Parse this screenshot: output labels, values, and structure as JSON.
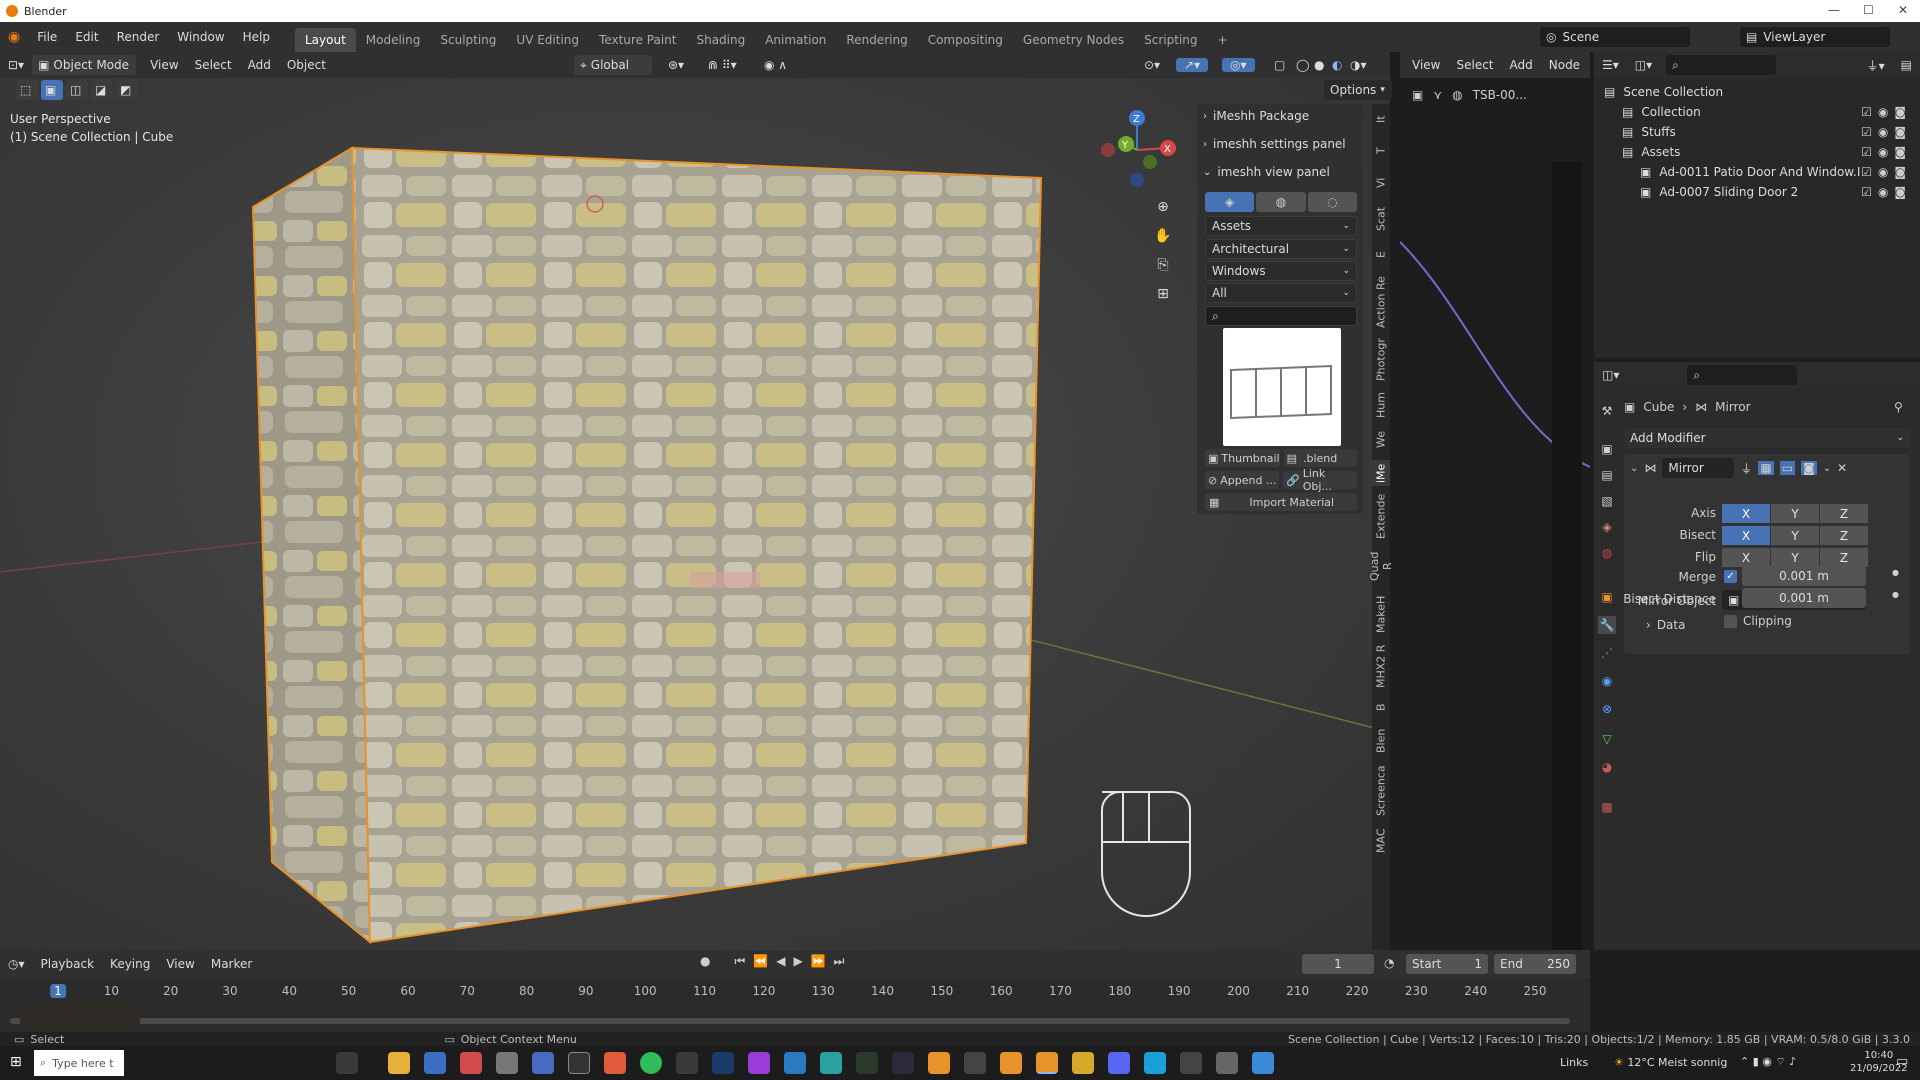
{
  "window": {
    "title": "Blender"
  },
  "menus": [
    "File",
    "Edit",
    "Render",
    "Window",
    "Help"
  ],
  "workspaces": [
    {
      "label": "Layout",
      "active": true
    },
    {
      "label": "Modeling"
    },
    {
      "label": "Sculpting"
    },
    {
      "label": "UV Editing"
    },
    {
      "label": "Texture Paint"
    },
    {
      "label": "Shading"
    },
    {
      "label": "Animation"
    },
    {
      "label": "Rendering"
    },
    {
      "label": "Compositing"
    },
    {
      "label": "Geometry Nodes"
    },
    {
      "label": "Scripting"
    }
  ],
  "scene": {
    "label": "Scene",
    "view_layer": "ViewLayer"
  },
  "viewport": {
    "mode": "Object Mode",
    "menus": [
      "View",
      "Select",
      "Add",
      "Object"
    ],
    "orientation": "Global",
    "options": "Options",
    "perspective": "User Perspective",
    "collection_info": "(1) Scene Collection | Cube",
    "gizmo": {
      "x": "X",
      "y": "Y",
      "z": "Z"
    }
  },
  "npanel": {
    "sections": [
      {
        "label": "iMeshh Package",
        "open": false
      },
      {
        "label": "imeshh settings panel",
        "open": false
      },
      {
        "label": "imeshh view panel",
        "open": true
      }
    ],
    "dropdowns": [
      "Assets",
      "Architectural",
      "Windows",
      "All"
    ],
    "thumbnail_btn": "Thumbnail",
    "blend_btn": ".blend",
    "append_btn": "Append ...",
    "link_btn": "Link Obj...",
    "import_material": "Import Material"
  },
  "vtabs": [
    "It",
    "T",
    "Vi",
    "Scat",
    "E",
    "Action Re",
    "Photogr",
    "Hum",
    "We",
    "iMe",
    "Extende",
    "Quad R",
    "MakeH",
    "MHX2 R",
    "B",
    "Blen",
    "Screenca",
    "MAC"
  ],
  "node_editor": {
    "menus": [
      "View",
      "Select",
      "Add",
      "Node"
    ],
    "breadcrumb": "TSB-00..."
  },
  "outliner": {
    "rows": [
      {
        "label": "Scene Collection",
        "depth": 0
      },
      {
        "label": "Collection",
        "depth": 1
      },
      {
        "label": "Stuffs",
        "depth": 1
      },
      {
        "label": "Assets",
        "depth": 1
      },
      {
        "label": "Ad-0011 Patio Door And Window.I",
        "depth": 2
      },
      {
        "label": "Ad-0007 Sliding Door 2",
        "depth": 2
      }
    ]
  },
  "properties": {
    "object": "Cube",
    "modifier_crumb": "Mirror",
    "add_modifier": "Add Modifier",
    "modifier_name": "Mirror",
    "axis_label": "Axis",
    "bisect_label": "Bisect",
    "flip_label": "Flip",
    "axis": {
      "x": true,
      "y": false,
      "z": false
    },
    "bisect": {
      "x": true,
      "y": false,
      "z": false
    },
    "flip": {
      "x": false,
      "y": false,
      "z": false
    },
    "xyz": [
      "X",
      "Y",
      "Z"
    ],
    "mirror_object_label": "Mirror Object",
    "clipping_label": "Clipping",
    "clipping": false,
    "merge_label": "Merge",
    "merge": true,
    "merge_value": "0.001 m",
    "bisect_distance_label": "Bisect Distance",
    "bisect_distance": "0.001 m",
    "data_label": "Data"
  },
  "timeline": {
    "menus": [
      "Playback",
      "Keying",
      "View",
      "Marker"
    ],
    "current_frame": "1",
    "start_label": "Start",
    "start": "1",
    "end_label": "End",
    "end": "250",
    "ticks": [
      "1",
      "10",
      "20",
      "30",
      "40",
      "50",
      "60",
      "70",
      "80",
      "90",
      "100",
      "110",
      "120",
      "130",
      "140",
      "150",
      "160",
      "170",
      "180",
      "190",
      "200",
      "210",
      "220",
      "230",
      "240",
      "250"
    ]
  },
  "status": {
    "left": "Select",
    "middle": "Object Context Menu",
    "right": "Scene Collection | Cube | Verts:12 | Faces:10 | Tris:20 | Objects:1/2 | Memory: 1.85 GB | VRAM: 0.5/8.0 GiB | 3.3.0"
  },
  "taskbar": {
    "search": "Type here t",
    "links": "Links",
    "weather": "12°C  Meist sonnig",
    "time": "10:40",
    "date": "21/09/2022"
  },
  "colors": {
    "accent": "#4772b3",
    "selection": "#e8922a",
    "header": "#303030"
  }
}
